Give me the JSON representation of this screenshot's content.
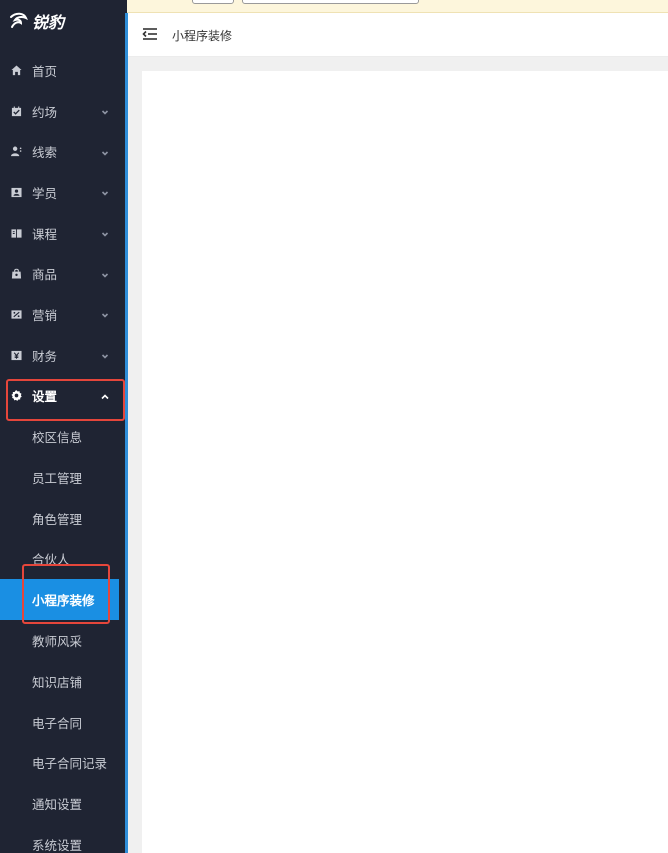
{
  "brand": {
    "name": "锐豹"
  },
  "sidebar": {
    "items": [
      {
        "label": "首页",
        "icon": "home-icon",
        "has_arrow": false
      },
      {
        "label": "约场",
        "icon": "calendar-check-icon",
        "has_arrow": true
      },
      {
        "label": "线索",
        "icon": "user-clue-icon",
        "has_arrow": true
      },
      {
        "label": "学员",
        "icon": "id-card-icon",
        "has_arrow": true
      },
      {
        "label": "课程",
        "icon": "book-icon",
        "has_arrow": true
      },
      {
        "label": "商品",
        "icon": "shopping-bag-icon",
        "has_arrow": true
      },
      {
        "label": "营销",
        "icon": "percent-icon",
        "has_arrow": true
      },
      {
        "label": "财务",
        "icon": "yuan-icon",
        "has_arrow": true
      },
      {
        "label": "设置",
        "icon": "gear-icon",
        "has_arrow": true,
        "open": true
      }
    ],
    "settings_children": [
      {
        "label": "校区信息"
      },
      {
        "label": "员工管理"
      },
      {
        "label": "角色管理"
      },
      {
        "label": "合伙人"
      },
      {
        "label": "小程序装修",
        "active": true
      },
      {
        "label": "教师风采"
      },
      {
        "label": "知识店铺"
      },
      {
        "label": "电子合同"
      },
      {
        "label": "电子合同记录"
      },
      {
        "label": "通知设置"
      },
      {
        "label": "系统设置"
      }
    ]
  },
  "header": {
    "breadcrumb": "小程序装修"
  },
  "colors": {
    "sidebar_bg": "#1f2433",
    "accent": "#1a8fe3",
    "highlight": "#e5463b"
  }
}
